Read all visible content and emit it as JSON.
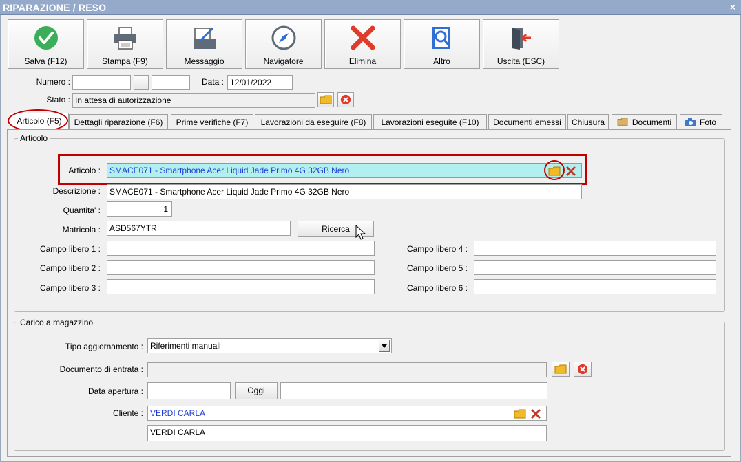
{
  "window": {
    "title": "RIPARAZIONE / RESO",
    "close_glyph": "×"
  },
  "toolbar": [
    {
      "label": "Salva (F12)",
      "icon": "check-circle-icon"
    },
    {
      "label": "Stampa (F9)",
      "icon": "printer-icon"
    },
    {
      "label": "Messaggio",
      "icon": "message-icon"
    },
    {
      "label": "Navigatore",
      "icon": "compass-icon"
    },
    {
      "label": "Elimina",
      "icon": "delete-x-icon"
    },
    {
      "label": "Altro",
      "icon": "search-document-icon"
    },
    {
      "label": "Uscita (ESC)",
      "icon": "exit-door-icon"
    }
  ],
  "header": {
    "numero_label": "Numero :",
    "numero_value": "",
    "data_label": "Data :",
    "data_value": "12/01/2022",
    "stato_label": "Stato :",
    "stato_value": "In attesa di autorizzazione"
  },
  "tabs": [
    {
      "label": "Articolo (F5)",
      "active": true
    },
    {
      "label": "Dettagli riparazione (F6)"
    },
    {
      "label": "Prime verifiche (F7)"
    },
    {
      "label": "Lavorazioni da eseguire (F8)"
    },
    {
      "label": "Lavorazioni eseguite  (F10)"
    },
    {
      "label": "Documenti emessi"
    },
    {
      "label": "Chiusura"
    },
    {
      "label": "Documenti",
      "icon": "folder-icon"
    },
    {
      "label": "Foto",
      "icon": "camera-icon"
    }
  ],
  "articolo": {
    "group_title": "Articolo",
    "articolo_label": "Articolo :",
    "articolo_value": "SMACE071 - Smartphone Acer Liquid Jade Primo 4G 32GB Nero",
    "descrizione_label": "Descrizione :",
    "descrizione_value": "SMACE071 - Smartphone Acer Liquid Jade Primo 4G 32GB Nero",
    "quantita_label": "Quantita' :",
    "quantita_value": "1",
    "matricola_label": "Matricola :",
    "matricola_value": "ASD567YTR",
    "ricerca_label": "Ricerca",
    "campi": [
      {
        "label": "Campo libero 1 :",
        "value": ""
      },
      {
        "label": "Campo libero 2 :",
        "value": ""
      },
      {
        "label": "Campo libero 3 :",
        "value": ""
      },
      {
        "label": "Campo libero 4 :",
        "value": ""
      },
      {
        "label": "Campo libero 5 :",
        "value": ""
      },
      {
        "label": "Campo libero 6 :",
        "value": ""
      }
    ]
  },
  "magazzino": {
    "group_title": "Carico a magazzino",
    "tipo_label": "Tipo aggiornamento :",
    "tipo_value": "Riferimenti manuali",
    "documento_label": "Documento di entrata :",
    "documento_value": "",
    "data_apertura_label": "Data apertura :",
    "data_apertura_value": "",
    "oggi_label": "Oggi",
    "cliente_label": "Cliente :",
    "cliente_value": "VERDI CARLA",
    "cliente_name": "VERDI CARLA"
  },
  "colors": {
    "titlebar": "#95aacb",
    "highlight": "#c00000",
    "link_blue": "#1f3dd6",
    "cyan_field": "#b2efef"
  }
}
